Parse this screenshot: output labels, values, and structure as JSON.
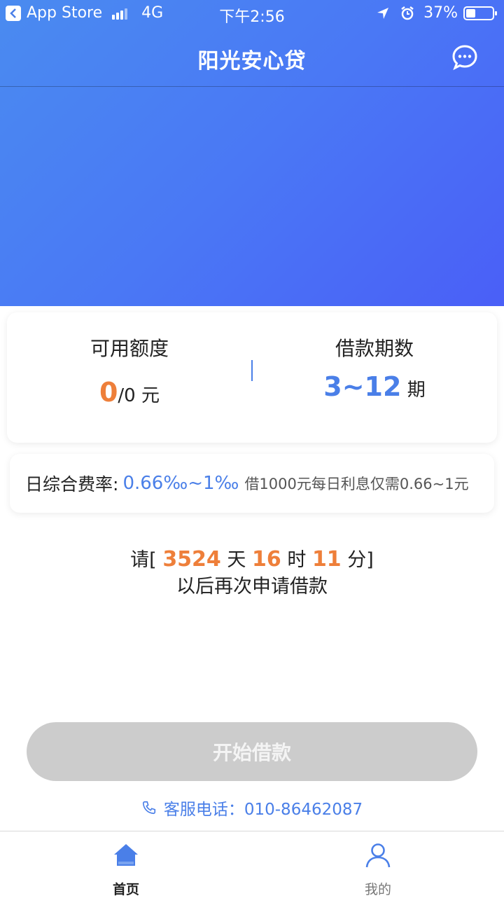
{
  "status_bar": {
    "back_app": "App Store",
    "network": "4G",
    "time": "下午2:56",
    "battery": "37%",
    "battery_level": 0.37
  },
  "nav": {
    "title": "阳光安心贷",
    "chat_icon": "chat-bubble-icon"
  },
  "credit": {
    "available_label": "可用额度",
    "available_value": "0",
    "available_total": "/0",
    "available_unit": "元",
    "term_label": "借款期数",
    "term_value": "3~12",
    "term_unit": "期"
  },
  "rate": {
    "label": "日综合费率:",
    "value": "0.66‰~1‰",
    "note": "借1000元每日利息仅需0.66~1元"
  },
  "countdown": {
    "prefix": "请[",
    "days": "3524",
    "days_unit": "天",
    "hours": "16",
    "hours_unit": "时",
    "minutes": "11",
    "minutes_unit": "分]",
    "suffix": "以后再次申请借款"
  },
  "start_button": "开始借款",
  "service": {
    "label": "客服电话：010-86462087",
    "icon": "phone-icon"
  },
  "tabs": [
    {
      "label": "首页",
      "icon": "home-icon",
      "active": true
    },
    {
      "label": "我的",
      "icon": "person-icon",
      "active": false
    }
  ],
  "colors": {
    "accent_blue": "#4a7fe8",
    "accent_orange": "#ee7f3a",
    "button_disabled": "#cccccc"
  }
}
